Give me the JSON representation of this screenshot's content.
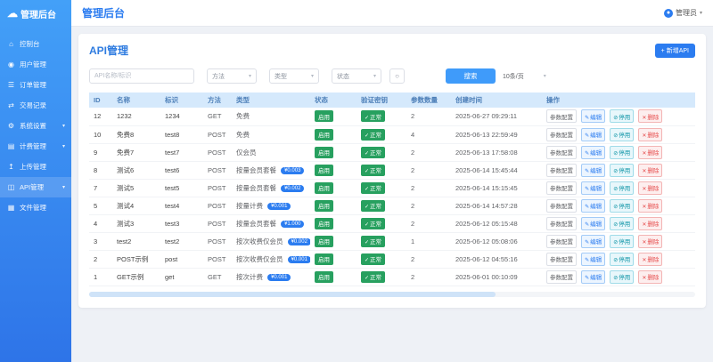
{
  "colors": {
    "primary": "#2b7cf0",
    "sidebar_gradient_top": "#43a0f8",
    "sidebar_gradient_bottom": "#2e74e8",
    "success_badge": "#27a05f",
    "danger": "#e64c4c",
    "table_header_bg": "#d5e9fc"
  },
  "topbar": {
    "title": "管理后台",
    "user_label": "管理员",
    "chevron": "▾"
  },
  "sidebar": {
    "logo_text": "管理后台",
    "logo_icon_glyph": "☁",
    "items": [
      {
        "label": "控制台",
        "icon": "dashboard-icon",
        "glyph": "⌂",
        "expandable": false,
        "active": false
      },
      {
        "label": "用户管理",
        "icon": "users-icon",
        "glyph": "◉",
        "expandable": false,
        "active": false
      },
      {
        "label": "订单管理",
        "icon": "orders-icon",
        "glyph": "☰",
        "expandable": false,
        "active": false
      },
      {
        "label": "交易记录",
        "icon": "transactions-icon",
        "glyph": "⇄",
        "expandable": false,
        "active": false
      },
      {
        "label": "系统设置",
        "icon": "settings-icon",
        "glyph": "⚙",
        "expandable": true,
        "active": false
      },
      {
        "label": "计费管理",
        "icon": "billing-icon",
        "glyph": "▤",
        "expandable": true,
        "active": false
      },
      {
        "label": "上传管理",
        "icon": "upload-icon",
        "glyph": "↥",
        "expandable": false,
        "active": false
      },
      {
        "label": "API管理",
        "icon": "api-icon",
        "glyph": "◫",
        "expandable": true,
        "active": true
      },
      {
        "label": "文件管理",
        "icon": "files-icon",
        "glyph": "▦",
        "expandable": false,
        "active": false
      }
    ],
    "chevron": "▾"
  },
  "page": {
    "title": "API管理",
    "add_button_label": "+ 新增API"
  },
  "filters": {
    "keyword_placeholder": "API名称/标识",
    "method_label": "方法",
    "type_label": "类型",
    "status_label": "状态",
    "reset_icon_glyph": "○",
    "search_label": "搜索",
    "page_size_label": "10条/页",
    "chevron": "▾"
  },
  "table": {
    "headers": [
      "ID",
      "名称",
      "标识",
      "方法",
      "类型",
      "状态",
      "验证密钥",
      "参数数量",
      "创建时间",
      "操作"
    ],
    "rows": [
      {
        "id": "12",
        "name": "1232",
        "code": "1234",
        "method": "GET",
        "type": "免费",
        "price": null,
        "status": "启用",
        "verify": "正常",
        "params": "2",
        "created": "2025-06-27 09:29:11"
      },
      {
        "id": "10",
        "name": "免费8",
        "code": "test8",
        "method": "POST",
        "type": "免费",
        "price": null,
        "status": "启用",
        "verify": "正常",
        "params": "4",
        "created": "2025-06-13 22:59:49"
      },
      {
        "id": "9",
        "name": "免费7",
        "code": "test7",
        "method": "POST",
        "type": "仅会员",
        "price": null,
        "status": "启用",
        "verify": "正常",
        "params": "2",
        "created": "2025-06-13 17:58:08"
      },
      {
        "id": "8",
        "name": "测试6",
        "code": "test6",
        "method": "POST",
        "type": "按量会员套餐",
        "price": "¥0.003",
        "status": "启用",
        "verify": "正常",
        "params": "2",
        "created": "2025-06-14 15:45:44"
      },
      {
        "id": "7",
        "name": "测试5",
        "code": "test5",
        "method": "POST",
        "type": "按量会员套餐",
        "price": "¥0.002",
        "status": "启用",
        "verify": "正常",
        "params": "2",
        "created": "2025-06-14 15:15:45"
      },
      {
        "id": "5",
        "name": "测试4",
        "code": "test4",
        "method": "POST",
        "type": "按量计费",
        "price": "¥0.001",
        "status": "启用",
        "verify": "正常",
        "params": "2",
        "created": "2025-06-14 14:57:28"
      },
      {
        "id": "4",
        "name": "测试3",
        "code": "test3",
        "method": "POST",
        "type": "按量会员套餐",
        "price": "¥1.000",
        "status": "启用",
        "verify": "正常",
        "params": "2",
        "created": "2025-06-12 05:15:48"
      },
      {
        "id": "3",
        "name": "test2",
        "code": "test2",
        "method": "POST",
        "type": "按次收费仅会员",
        "price": "¥0.002",
        "status": "启用",
        "verify": "正常",
        "params": "1",
        "created": "2025-06-12 05:08:06"
      },
      {
        "id": "2",
        "name": "POST示例",
        "code": "post",
        "method": "POST",
        "type": "按次收费仅会员",
        "price": "¥0.001",
        "status": "启用",
        "verify": "正常",
        "params": "2",
        "created": "2025-06-12 04:55:16"
      },
      {
        "id": "1",
        "name": "GET示例",
        "code": "get",
        "method": "GET",
        "type": "按次计费",
        "price": "¥0.001",
        "status": "启用",
        "verify": "正常",
        "params": "2",
        "created": "2025-06-01 00:10:09"
      }
    ]
  },
  "row_actions": {
    "params_label": "参数配置",
    "edit_label": "编辑",
    "disable_label": "停用",
    "delete_label": "删除",
    "edit_icon_glyph": "✎",
    "disable_icon_glyph": "⊘",
    "delete_icon_glyph": "✕",
    "check_icon_glyph": "✓"
  }
}
